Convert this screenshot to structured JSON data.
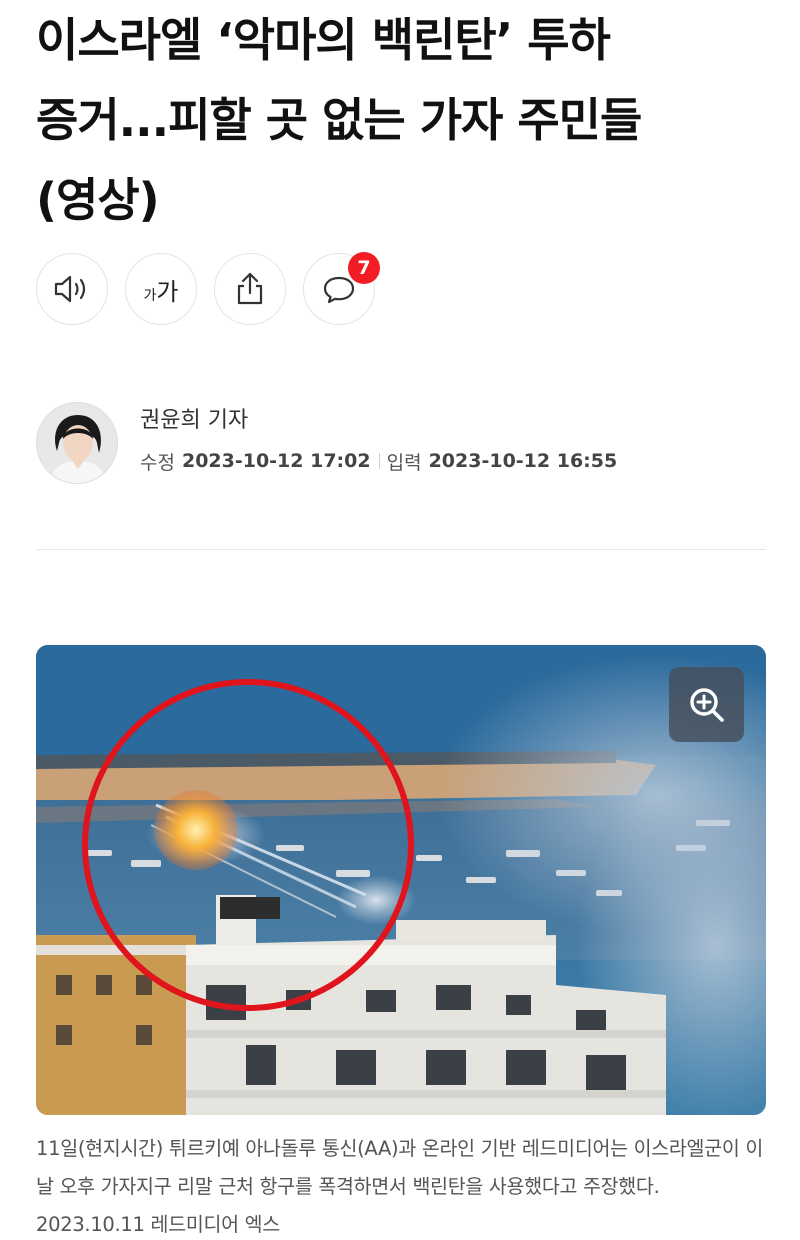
{
  "article": {
    "headline_line1": "이스라엘 ‘악마의 백린탄’ 투하",
    "headline_line2": "증거...피할 곳 없는 가자 주민들",
    "headline_line3": "(영상)"
  },
  "actions": {
    "font_button_small": "가",
    "font_button_large": "가",
    "comment_count": "7",
    "icons": [
      "speaker-icon",
      "font-size-icon",
      "share-icon",
      "comment-icon"
    ]
  },
  "author": {
    "name": "권윤희 기자",
    "modified_label": "수정",
    "modified_value": "2023-10-12 17:02",
    "published_label": "입력",
    "published_value": "2023-10-12 16:55"
  },
  "photo": {
    "zoom_icon": "zoom-in-icon",
    "caption": "11일(현지시간) 튀르키예 아나돌루 통신(AA)과 온라인 기반 레드미디어는 이스라엘군이 이날 오후 가자지구 리말 근처 항구를 폭격하면서 백린탄을 사용했다고 주장했다. 2023.10.11 레드미디어 엑스"
  },
  "colors": {
    "badge": "#f21d24",
    "highlight_circle": "#e0141c"
  }
}
